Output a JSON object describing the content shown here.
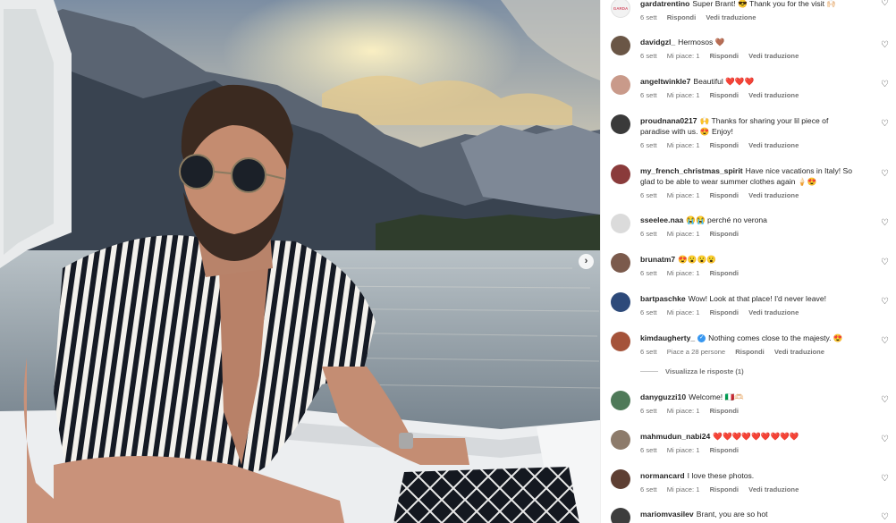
{
  "actions": {
    "reply": "Rispondi",
    "translate": "Vedi traduzione"
  },
  "carousel": {
    "next_label": "›"
  },
  "comments": [
    {
      "user": "gardatrentino",
      "text": "Super Brant! 😎 Thank you for the visit 🙌🏻",
      "time": "6 sett",
      "likes": "",
      "translate": true,
      "avatar_color": "#f2f2f2",
      "avatar_label": "GARDA"
    },
    {
      "user": "davidgzl_",
      "text": "Hermosos 🤎",
      "time": "6 sett",
      "likes": "Mi piace: 1",
      "translate": true,
      "avatar_color": "#6a5646"
    },
    {
      "user": "angeltwinkle7",
      "text": "Beautiful ❤️❤️❤️",
      "time": "6 sett",
      "likes": "Mi piace: 1",
      "translate": true,
      "avatar_color": "#c99a8a"
    },
    {
      "user": "proudnana0217",
      "text": "🙌 Thanks for sharing your lil piece of paradise with us. 😍 Enjoy!",
      "time": "6 sett",
      "likes": "Mi piace: 1",
      "translate": true,
      "avatar_color": "#3a3a3a"
    },
    {
      "user": "my_french_christmas_spirit",
      "text": "Have nice vacations in Italy! So glad to be able to wear summer clothes again 🍦😍",
      "time": "6 sett",
      "likes": "Mi piace: 1",
      "translate": true,
      "avatar_color": "#8a3b3b"
    },
    {
      "user": "sseelee.naa",
      "text": "😭😭 perché no verona",
      "time": "6 sett",
      "likes": "Mi piace: 1",
      "translate": false,
      "avatar_color": "#dbdbdb"
    },
    {
      "user": "brunatm7",
      "text": "😍😮😮😮",
      "time": "6 sett",
      "likes": "Mi piace: 1",
      "translate": false,
      "avatar_color": "#7b5a4c"
    },
    {
      "user": "bartpaschke",
      "text": "Wow! Look at that place! I'd never leave!",
      "time": "6 sett",
      "likes": "Mi piace: 1",
      "translate": true,
      "avatar_color": "#2d4a7a"
    },
    {
      "user": "kimdaugherty_",
      "text": "Nothing comes close to the majesty. 😍",
      "time": "6 sett",
      "likes": "Piace a 28 persone",
      "translate": true,
      "verified": true,
      "avatar_color": "#a5533a",
      "replies": "Visualizza le risposte (1)"
    },
    {
      "user": "danyguzzi10",
      "text": "Welcome! 🇮🇹🫶🏻",
      "time": "6 sett",
      "likes": "Mi piace: 1",
      "translate": false,
      "avatar_color": "#4f7a59"
    },
    {
      "user": "mahmudun_nabi24",
      "text": "❤️❤️❤️❤️❤️❤️❤️❤️❤️",
      "time": "6 sett",
      "likes": "Mi piace: 1",
      "translate": false,
      "avatar_color": "#8d7b6b"
    },
    {
      "user": "normancard",
      "text": "I love these photos.",
      "time": "6 sett",
      "likes": "Mi piace: 1",
      "translate": true,
      "avatar_color": "#5e3f33"
    },
    {
      "user": "mariomvasilev",
      "text": "Brant, you are so hot",
      "time": "",
      "likes": "",
      "translate": false,
      "avatar_color": "#3d3d3d"
    }
  ]
}
